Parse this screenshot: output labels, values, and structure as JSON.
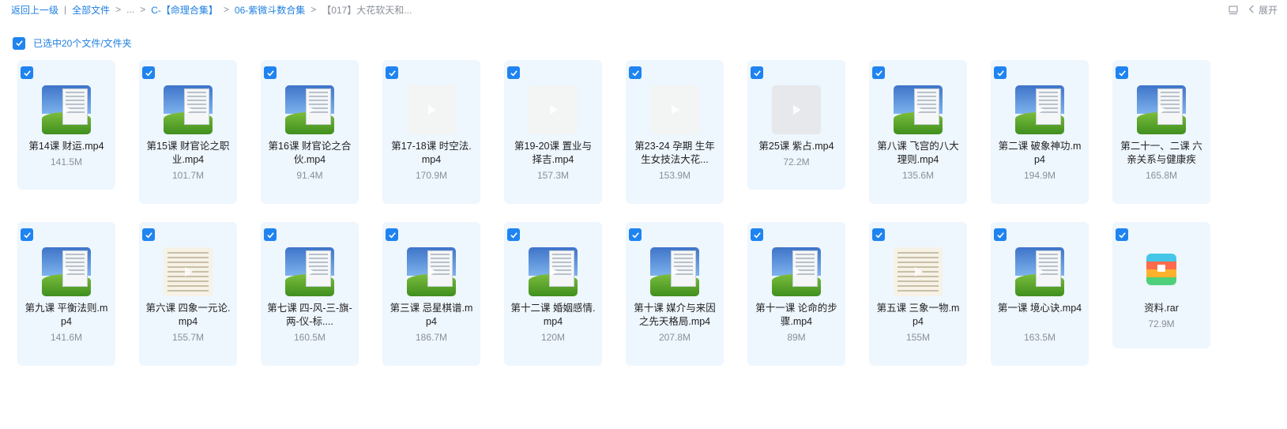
{
  "breadcrumb": {
    "back": "返回上一级",
    "items": [
      "全部文件",
      "...",
      "C-【命理合集】",
      "06-紫微斗数合集"
    ],
    "current": "【017】大花软天和..."
  },
  "toolbar": {
    "expand_label": "展开"
  },
  "selection": {
    "label": "已选中20个文件/文件夹"
  },
  "files": [
    {
      "name": "第14课 财运.mp4",
      "size": "141.5M",
      "thumb": "xp"
    },
    {
      "name": "第15课 财官论之职业.mp4",
      "size": "101.7M",
      "thumb": "xp"
    },
    {
      "name": "第16课 财官论之合伙.mp4",
      "size": "91.4M",
      "thumb": "xp"
    },
    {
      "name": "第17-18课 时空法.mp4",
      "size": "170.9M",
      "thumb": "light"
    },
    {
      "name": "第19-20课 置业与择吉.mp4",
      "size": "157.3M",
      "thumb": "light"
    },
    {
      "name": "第23-24 孕期 生年生女技法大花...",
      "size": "153.9M",
      "thumb": "light"
    },
    {
      "name": "第25课 紫占.mp4",
      "size": "72.2M",
      "thumb": "grey"
    },
    {
      "name": "第八课 飞宫的八大理则.mp4",
      "size": "135.6M",
      "thumb": "xp"
    },
    {
      "name": "第二课 破象神功.mp4",
      "size": "194.9M",
      "thumb": "xp"
    },
    {
      "name": "第二十一、二课 六亲关系与健康疾",
      "size": "165.8M",
      "thumb": "xp"
    },
    {
      "name": "第九课 平衡法则.mp4",
      "size": "141.6M",
      "thumb": "xp"
    },
    {
      "name": "第六课 四象一元论.mp4",
      "size": "155.7M",
      "thumb": "doc"
    },
    {
      "name": "第七课 四-风-三-旗-两-仪-标....",
      "size": "160.5M",
      "thumb": "xp"
    },
    {
      "name": "第三课 忌星棋谱.mp4",
      "size": "186.7M",
      "thumb": "xp"
    },
    {
      "name": "第十二课 婚姻感情.mp4",
      "size": "120M",
      "thumb": "xp"
    },
    {
      "name": "第十课 媒介与来因之先天格局.mp4",
      "size": "207.8M",
      "thumb": "xp"
    },
    {
      "name": "第十一课 论命的步骤.mp4",
      "size": "89M",
      "thumb": "xp"
    },
    {
      "name": "第五课 三象一物.mp4",
      "size": "155M",
      "thumb": "doc"
    },
    {
      "name": "第一课 境心诀.mp4",
      "size": "163.5M",
      "thumb": "xp"
    },
    {
      "name": "资料.rar",
      "size": "72.9M",
      "thumb": "rar"
    }
  ],
  "colors": {
    "accent": "#1f84f0",
    "card_bg": "#eef6fe",
    "muted": "#8a8f99"
  }
}
